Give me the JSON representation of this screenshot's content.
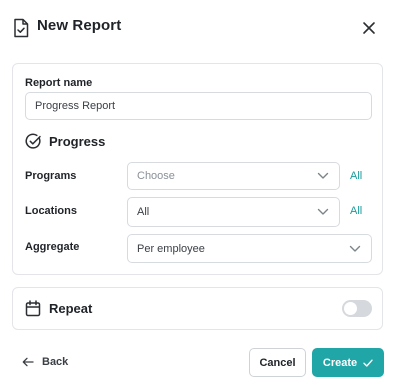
{
  "header": {
    "title": "New Report",
    "icon": "document-check-icon",
    "close_icon": "close-icon"
  },
  "form": {
    "report_name_label": "Report name",
    "report_name_value": "Progress Report",
    "progress_section_title": "Progress",
    "progress_icon": "check-circle-icon",
    "programs": {
      "label": "Programs",
      "placeholder": "Choose",
      "link": "All"
    },
    "locations": {
      "label": "Locations",
      "value": "All",
      "link": "All"
    },
    "aggregate": {
      "label": "Aggregate",
      "value": "Per employee"
    }
  },
  "repeat": {
    "title": "Repeat",
    "icon": "calendar-icon",
    "enabled": false
  },
  "footer": {
    "back_label": "Back",
    "cancel_label": "Cancel",
    "create_label": "Create"
  },
  "colors": {
    "accent": "#21a6a8",
    "link": "#1a9a9b",
    "border": "#e3e5e8"
  }
}
